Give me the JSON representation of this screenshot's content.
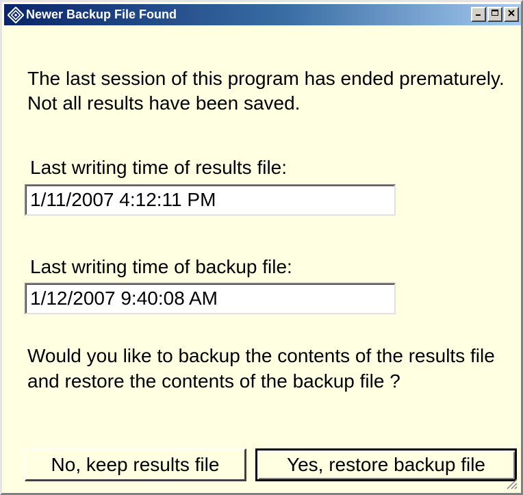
{
  "window": {
    "title": "Newer Backup File Found",
    "controls": {
      "minimize_icon": "minimize-icon",
      "maximize_icon": "maximize-icon",
      "close_icon": "close-icon"
    }
  },
  "dialog": {
    "message": "The last session of this program has ended prematurely. Not all results have been saved.",
    "results_label": "Last writing time of results file:",
    "results_time": "1/11/2007 4:12:11 PM",
    "backup_label": "Last writing time of backup file:",
    "backup_time": "1/12/2007 9:40:08 AM",
    "question": "Would you like to backup the contents of the results file and restore the contents of the backup file ?"
  },
  "buttons": {
    "no_label": "No, keep results file",
    "yes_label": "Yes, restore backup file"
  },
  "colors": {
    "dialog_background": "#ffffe1",
    "titlebar_start": "#0a246a",
    "titlebar_end": "#a6caf0"
  }
}
